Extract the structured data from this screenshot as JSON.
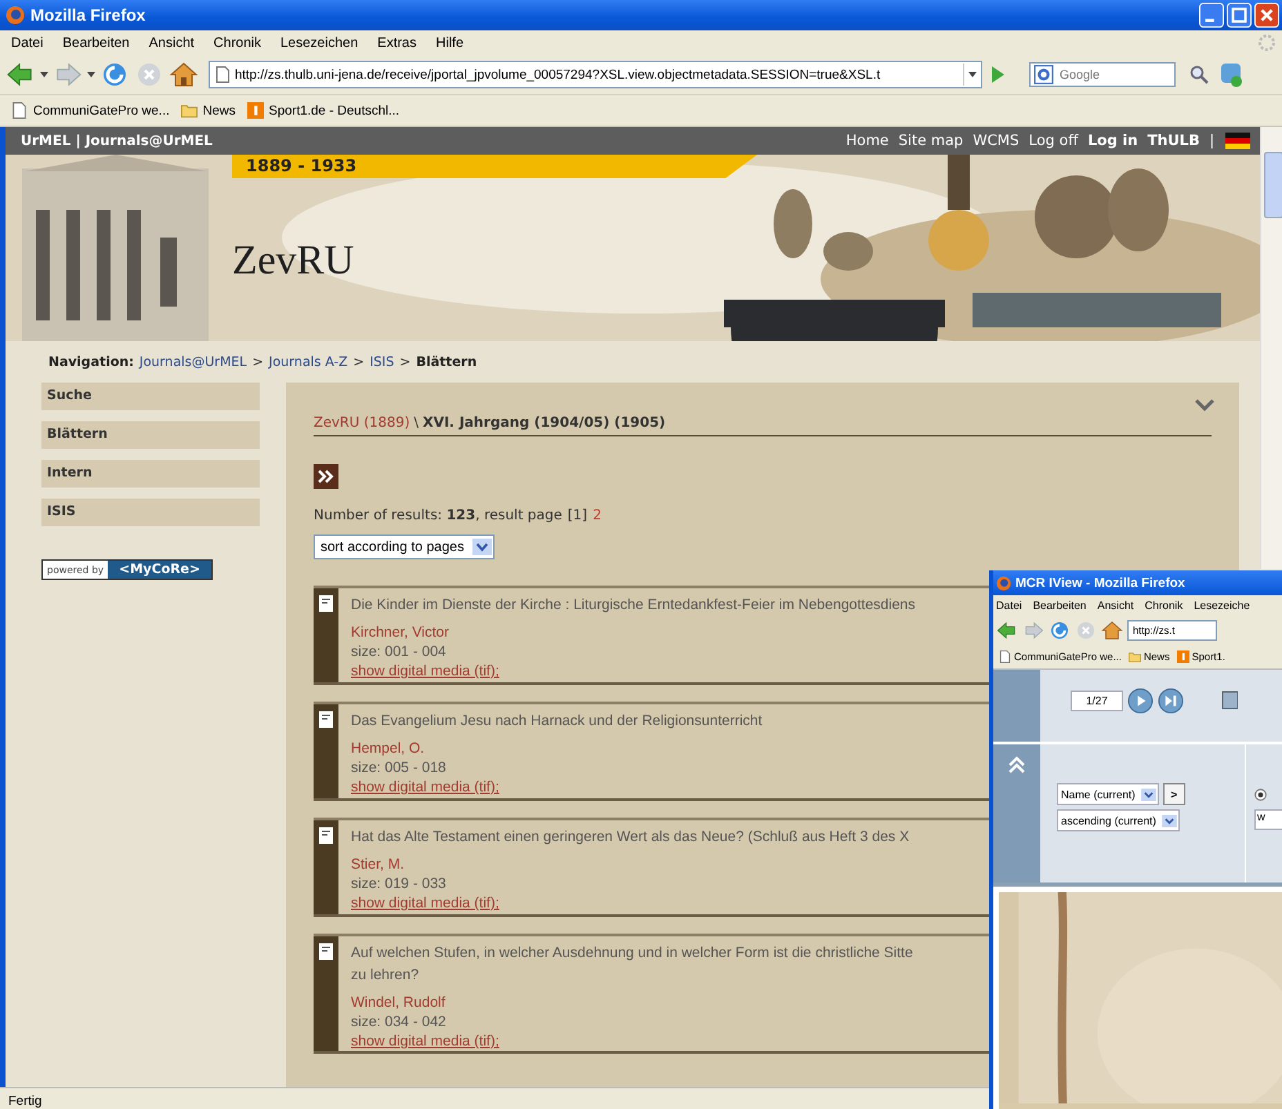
{
  "browser": {
    "title": "Mozilla Firefox",
    "menu": [
      "Datei",
      "Bearbeiten",
      "Ansicht",
      "Chronik",
      "Lesezeichen",
      "Extras",
      "Hilfe"
    ],
    "url": "http://zs.thulb.uni-jena.de/receive/jportal_jpvolume_00057294?XSL.view.objectmetadata.SESSION=true&XSL.t",
    "search_placeholder": "Google",
    "bookmarks": [
      {
        "kind": "page",
        "label": "CommuniGatePro we..."
      },
      {
        "kind": "folder",
        "label": "News"
      },
      {
        "kind": "badge",
        "label": "Sport1.de - Deutschl..."
      }
    ],
    "status": "Fertig"
  },
  "site": {
    "brand": "UrMEL | Journals@UrMEL",
    "links": [
      {
        "label": "Home",
        "bold": false
      },
      {
        "label": "Site map",
        "bold": false
      },
      {
        "label": "WCMS",
        "bold": false
      },
      {
        "label": "Log off",
        "bold": false
      },
      {
        "label": "Log in",
        "bold": true
      },
      {
        "label": "ThULB",
        "bold": true
      }
    ],
    "link_separator": "|",
    "years": "1889 - 1933",
    "journal": "ZevRU"
  },
  "breadcrumb": {
    "label": "Navigation:",
    "items": [
      "Journals@UrMEL",
      "Journals A-Z",
      "ISIS"
    ],
    "separator": ">",
    "current": "Blättern"
  },
  "sidebar": {
    "items": [
      "Suche",
      "Blättern",
      "Intern",
      "ISIS"
    ],
    "powered_label": "powered by",
    "powered_logo": "<MyCoRe>"
  },
  "volume": {
    "parent": "ZevRU (1889)",
    "separator": "\\",
    "title": "XVI. Jahrgang (1904/05) (1905)"
  },
  "results": {
    "summary": "Number of results: **123**, result page",
    "pages": [
      {
        "label": "[1]",
        "selected": true
      },
      {
        "label": "2",
        "selected": false
      }
    ]
  },
  "sort": "sort according to pages",
  "items": [
    {
      "title_lines": [
        "Die Kinder im Dienste der Kirche : Liturgische Erntedankfest-Feier im Nebengottesdiens"
      ],
      "author": "Kirchner, Victor",
      "size": "size: 001 - 004",
      "media": "show digital media (tif);"
    },
    {
      "title_lines": [
        "Das Evangelium Jesu nach Harnack und der Religionsunterricht"
      ],
      "author": "Hempel, O.",
      "size": "size: 005 - 018",
      "media": "show digital media (tif);"
    },
    {
      "title_lines": [
        "Hat das Alte Testament einen geringeren Wert als das Neue? (Schluß aus Heft 3 des X"
      ],
      "author": "Stier, M.",
      "size": "size: 019 - 033",
      "media": "show digital media (tif);"
    },
    {
      "title_lines": [
        "Auf welchen Stufen, in welcher Ausdehnung und in welcher Form ist die christliche Sitte",
        "zu lehren?"
      ],
      "author": "Windel, Rudolf",
      "size": "size: 034 - 042",
      "media": "show digital media (tif);"
    }
  ],
  "viewer": {
    "title": "MCR IView - Mozilla Firefox",
    "menu": [
      "Datei",
      "Bearbeiten",
      "Ansicht",
      "Chronik",
      "Lesezeiche"
    ],
    "url": "http://zs.t",
    "bookmarks": [
      {
        "kind": "page",
        "label": "CommuniGatePro we..."
      },
      {
        "kind": "folder",
        "label": "News"
      },
      {
        "kind": "badge",
        "label": "Sport1."
      }
    ],
    "page": "1/27",
    "sort_field": "Name (current)",
    "next": ">",
    "order": "ascending (current)",
    "radio_checked": true,
    "field_value": "w",
    "scan": {
      "kind": "picture"
    }
  }
}
